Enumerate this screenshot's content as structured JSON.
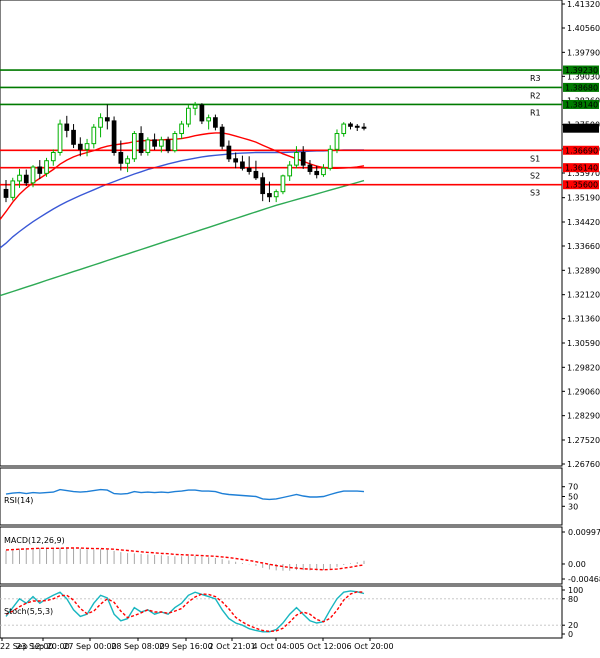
{
  "chart_data": {
    "type": "candlestick",
    "main": {
      "y_ticks": [
        "1.41320",
        "1.40560",
        "1.39790",
        "1.39030",
        "1.38260",
        "1.37500",
        "1.36730",
        "1.35970",
        "1.35190",
        "1.34420",
        "1.33660",
        "1.32890",
        "1.32120",
        "1.31360",
        "1.30590",
        "1.29820",
        "1.29060",
        "1.28290",
        "1.27520",
        "1.26760"
      ],
      "levels": [
        {
          "label": "R3",
          "value": 1.3923,
          "tag": "1.39230",
          "color": "#007a00"
        },
        {
          "label": "R2",
          "value": 1.3868,
          "tag": "1.38680",
          "color": "#007a00"
        },
        {
          "label": "R1",
          "value": 1.3814,
          "tag": "1.38140",
          "color": "#007a00"
        },
        {
          "label": "S1",
          "value": 1.3669,
          "tag": "1.36690",
          "color": "#ff0000"
        },
        {
          "label": "S2",
          "value": 1.3614,
          "tag": "1.36140",
          "color": "#ff0000"
        },
        {
          "label": "S3",
          "value": 1.356,
          "tag": "1.35600",
          "color": "#ff0000"
        }
      ],
      "current_price": "1.37389",
      "candles": [
        [
          1.3545,
          1.3575,
          1.3505,
          1.352
        ],
        [
          1.352,
          1.3582,
          1.351,
          1.3572
        ],
        [
          1.3572,
          1.361,
          1.355,
          1.359
        ],
        [
          1.359,
          1.3608,
          1.3556,
          1.3566
        ],
        [
          1.3566,
          1.3622,
          1.3552,
          1.3616
        ],
        [
          1.3616,
          1.3638,
          1.3578,
          1.3596
        ],
        [
          1.3596,
          1.3645,
          1.3585,
          1.3636
        ],
        [
          1.3636,
          1.3672,
          1.362,
          1.3662
        ],
        [
          1.3662,
          1.3766,
          1.3652,
          1.3752
        ],
        [
          1.3752,
          1.3778,
          1.371,
          1.3732
        ],
        [
          1.3732,
          1.3752,
          1.3676,
          1.3688
        ],
        [
          1.3688,
          1.371,
          1.365,
          1.3672
        ],
        [
          1.3672,
          1.3705,
          1.365,
          1.369
        ],
        [
          1.369,
          1.3752,
          1.3675,
          1.3742
        ],
        [
          1.3742,
          1.3786,
          1.371,
          1.3772
        ],
        [
          1.3772,
          1.3814,
          1.3735,
          1.3762
        ],
        [
          1.3762,
          1.3776,
          1.3652,
          1.3662
        ],
        [
          1.3662,
          1.37,
          1.3605,
          1.3628
        ],
        [
          1.3628,
          1.3652,
          1.36,
          1.3642
        ],
        [
          1.3642,
          1.373,
          1.3632,
          1.3722
        ],
        [
          1.3722,
          1.3745,
          1.3652,
          1.3662
        ],
        [
          1.3662,
          1.371,
          1.3652,
          1.3702
        ],
        [
          1.3702,
          1.3722,
          1.367,
          1.3682
        ],
        [
          1.3682,
          1.3712,
          1.3662,
          1.3702
        ],
        [
          1.3702,
          1.3712,
          1.366,
          1.3668
        ],
        [
          1.3668,
          1.373,
          1.3662,
          1.3722
        ],
        [
          1.3722,
          1.3762,
          1.3705,
          1.3752
        ],
        [
          1.3752,
          1.3812,
          1.3742,
          1.3802
        ],
        [
          1.3802,
          1.3822,
          1.378,
          1.3812
        ],
        [
          1.3812,
          1.3818,
          1.3752,
          1.3762
        ],
        [
          1.3762,
          1.3782,
          1.3735,
          1.3772
        ],
        [
          1.3772,
          1.3782,
          1.3732,
          1.3742
        ],
        [
          1.3742,
          1.3752,
          1.3672,
          1.3682
        ],
        [
          1.3682,
          1.37,
          1.3632,
          1.3642
        ],
        [
          1.3642,
          1.3662,
          1.3612,
          1.3632
        ],
        [
          1.3632,
          1.3652,
          1.3605,
          1.3612
        ],
        [
          1.3612,
          1.365,
          1.3592,
          1.3602
        ],
        [
          1.3602,
          1.3636,
          1.3575,
          1.3582
        ],
        [
          1.3582,
          1.3598,
          1.3508,
          1.3532
        ],
        [
          1.3532,
          1.357,
          1.3505,
          1.3522
        ],
        [
          1.3522,
          1.3545,
          1.3505,
          1.3538
        ],
        [
          1.3538,
          1.3592,
          1.353,
          1.3588
        ],
        [
          1.3588,
          1.3635,
          1.3572,
          1.3622
        ],
        [
          1.3622,
          1.3682,
          1.3612,
          1.3662
        ],
        [
          1.3662,
          1.3682,
          1.361,
          1.3622
        ],
        [
          1.3622,
          1.3638,
          1.3592,
          1.3602
        ],
        [
          1.3602,
          1.362,
          1.358,
          1.3592
        ],
        [
          1.3592,
          1.3625,
          1.3585,
          1.3612
        ],
        [
          1.3612,
          1.3685,
          1.3605,
          1.3672
        ],
        [
          1.3672,
          1.3735,
          1.366,
          1.3722
        ],
        [
          1.3722,
          1.3758,
          1.3712,
          1.3752
        ],
        [
          1.3752,
          1.3758,
          1.3735,
          1.3745
        ],
        [
          1.3745,
          1.3752,
          1.373,
          1.3742
        ],
        [
          1.3742,
          1.3755,
          1.3732,
          1.3739
        ]
      ],
      "ma_red": [
        1.3475,
        1.3505,
        1.353,
        1.355,
        1.3566,
        1.358,
        1.3594,
        1.3608,
        1.3625,
        1.3638,
        1.3648,
        1.3656,
        1.3662,
        1.3668,
        1.3676,
        1.3682,
        1.3686,
        1.3689,
        1.3692,
        1.3696,
        1.3699,
        1.37,
        1.3701,
        1.3702,
        1.3703,
        1.3704,
        1.3706,
        1.371,
        1.3715,
        1.3719,
        1.3722,
        1.3724,
        1.3724,
        1.372,
        1.3714,
        1.3708,
        1.3702,
        1.3695,
        1.3685,
        1.3676,
        1.3667,
        1.3658,
        1.365,
        1.3642,
        1.3634,
        1.3626,
        1.3619,
        1.3614,
        1.3612,
        1.3612,
        1.3613,
        1.3614,
        1.3616,
        1.362
      ],
      "ma_blue": [
        1.3375,
        1.3395,
        1.3412,
        1.3428,
        1.3443,
        1.3457,
        1.347,
        1.3483,
        1.3495,
        1.3506,
        1.3516,
        1.3526,
        1.3535,
        1.3544,
        1.3553,
        1.3562,
        1.357,
        1.3578,
        1.3586,
        1.3594,
        1.3601,
        1.3608,
        1.3614,
        1.362,
        1.3626,
        1.3631,
        1.3636,
        1.364,
        1.3644,
        1.3648,
        1.3651,
        1.3653,
        1.3655,
        1.3657,
        1.3659,
        1.366,
        1.3661,
        1.3662,
        1.3662,
        1.3662,
        1.3662,
        1.3662,
        1.3663,
        1.3664,
        1.3665,
        1.3666,
        1.3667,
        1.3667,
        1.3668,
        1.3669,
        1.367,
        1.367,
        1.367,
        1.367
      ],
      "ma_green": [
        1.3215,
        1.3222,
        1.3229,
        1.3236,
        1.3243,
        1.325,
        1.3257,
        1.3264,
        1.3271,
        1.3278,
        1.3285,
        1.3292,
        1.3299,
        1.3306,
        1.3313,
        1.332,
        1.3327,
        1.3334,
        1.3341,
        1.3348,
        1.3355,
        1.3362,
        1.3369,
        1.3376,
        1.3383,
        1.339,
        1.3397,
        1.3404,
        1.3411,
        1.3418,
        1.3425,
        1.3432,
        1.3439,
        1.3446,
        1.3453,
        1.346,
        1.3467,
        1.3474,
        1.3481,
        1.3488,
        1.3495,
        1.3501,
        1.3507,
        1.3513,
        1.3519,
        1.3525,
        1.3531,
        1.3537,
        1.3543,
        1.3549,
        1.3555,
        1.3561,
        1.3567,
        1.3573
      ]
    },
    "rsi": {
      "label": "RSI(14)",
      "ticks": [
        "70",
        "50",
        "30"
      ],
      "values": [
        55,
        57,
        58,
        56,
        58,
        57,
        58,
        59,
        64,
        62,
        60,
        59,
        60,
        62,
        64,
        63,
        56,
        55,
        56,
        60,
        58,
        59,
        58,
        59,
        58,
        60,
        61,
        63,
        63,
        61,
        61,
        60,
        56,
        54,
        53,
        52,
        51,
        50,
        45,
        44,
        45,
        48,
        51,
        54,
        51,
        49,
        49,
        50,
        54,
        58,
        61,
        61,
        61,
        60
      ]
    },
    "macd": {
      "label": "MACD(12,26,9)",
      "ticks": [
        "0.009979",
        "0.00",
        "-0.004686"
      ],
      "hist": [
        0.0042,
        0.0045,
        0.0048,
        0.0049,
        0.005,
        0.005,
        0.0049,
        0.0049,
        0.0051,
        0.0051,
        0.005,
        0.0048,
        0.0046,
        0.0045,
        0.0046,
        0.0045,
        0.0041,
        0.0037,
        0.0034,
        0.0033,
        0.0031,
        0.003,
        0.0028,
        0.0027,
        0.0025,
        0.0024,
        0.0024,
        0.0025,
        0.0025,
        0.0023,
        0.0021,
        0.0019,
        0.0015,
        0.0011,
        0.0007,
        0.0003,
        -0.0001,
        -0.0006,
        -0.0012,
        -0.0017,
        -0.002,
        -0.0021,
        -0.0021,
        -0.0019,
        -0.0019,
        -0.002,
        -0.002,
        -0.0019,
        -0.0015,
        -0.0009,
        -0.0003,
        0.0002,
        0.0006,
        0.001
      ],
      "signal": [
        0.0044,
        0.0045,
        0.0046,
        0.0047,
        0.0048,
        0.0049,
        0.0049,
        0.0049,
        0.0049,
        0.005,
        0.005,
        0.005,
        0.0049,
        0.0048,
        0.0048,
        0.0047,
        0.0046,
        0.0044,
        0.0042,
        0.004,
        0.0038,
        0.0036,
        0.0035,
        0.0033,
        0.0032,
        0.003,
        0.0029,
        0.0028,
        0.0027,
        0.0026,
        0.0025,
        0.0024,
        0.0022,
        0.002,
        0.0017,
        0.0014,
        0.0011,
        0.0007,
        0.0003,
        -0.0001,
        -0.0005,
        -0.0008,
        -0.0011,
        -0.0013,
        -0.0015,
        -0.0016,
        -0.0017,
        -0.0018,
        -0.0017,
        -0.0016,
        -0.0013,
        -0.001,
        -0.0006,
        -0.0003
      ]
    },
    "stoch": {
      "label": "Stoch(5,5,3)",
      "ticks": [
        "100",
        "80",
        "20",
        "0"
      ],
      "main_values": [
        40,
        60,
        80,
        70,
        85,
        70,
        80,
        88,
        95,
        80,
        55,
        40,
        45,
        70,
        88,
        82,
        45,
        30,
        35,
        60,
        50,
        55,
        45,
        50,
        45,
        60,
        70,
        88,
        95,
        90,
        85,
        80,
        55,
        35,
        25,
        20,
        12,
        8,
        5,
        5,
        10,
        25,
        45,
        60,
        45,
        30,
        25,
        28,
        55,
        80,
        95,
        98,
        96,
        92
      ],
      "signal_values": [
        45,
        52,
        62,
        70,
        75,
        75,
        76,
        80,
        87,
        88,
        77,
        58,
        46,
        52,
        68,
        80,
        72,
        52,
        37,
        42,
        48,
        55,
        50,
        50,
        47,
        52,
        58,
        73,
        84,
        91,
        90,
        85,
        73,
        57,
        38,
        27,
        19,
        13,
        8,
        6,
        7,
        13,
        27,
        43,
        50,
        45,
        33,
        28,
        36,
        54,
        77,
        91,
        96,
        95
      ]
    },
    "x_labels": [
      "22 Sep 12:00",
      "23 Sep 20:00",
      "27 Sep 00:00",
      "28 Sep 08:00",
      "29 Sep 16:00",
      "2 Oct 21:01",
      "4 Oct 04:00",
      "5 Oct 12:00",
      "6 Oct 20:00"
    ],
    "colors": {
      "bull": "#00b000",
      "bear": "#000000",
      "ma_red": "#ff0000",
      "ma_blue": "#3a58d6",
      "ma_green": "#2eaa55",
      "rsi": "#1e7fd6",
      "stoch_main": "#18b6c0",
      "stoch_signal": "#ff0000",
      "macd_hist": "#a6a6a6",
      "macd_signal": "#ff0000"
    }
  }
}
